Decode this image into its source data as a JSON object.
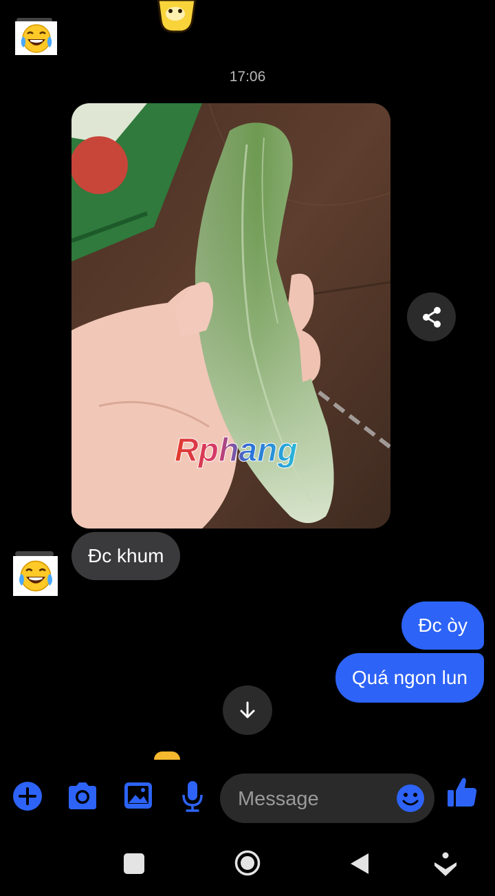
{
  "conversation": {
    "timestamp": "17:06",
    "watermark": "Rphang",
    "messages": {
      "incoming_1": "Đc khum",
      "outgoing_1": "Đc òy",
      "outgoing_2": "Quá ngon lun"
    }
  },
  "composer": {
    "placeholder": "Message",
    "icons": [
      "plus-icon",
      "camera-icon",
      "gallery-icon",
      "microphone-icon",
      "emoji-icon",
      "thumbs-up-icon"
    ]
  },
  "colors": {
    "accent": "#2d63f6",
    "incoming_bubble": "#3a3a3c",
    "background": "#000000"
  },
  "system_nav": {
    "icons": [
      "recents-square-icon",
      "home-circle-icon",
      "back-triangle-icon",
      "assistant-icon"
    ]
  }
}
